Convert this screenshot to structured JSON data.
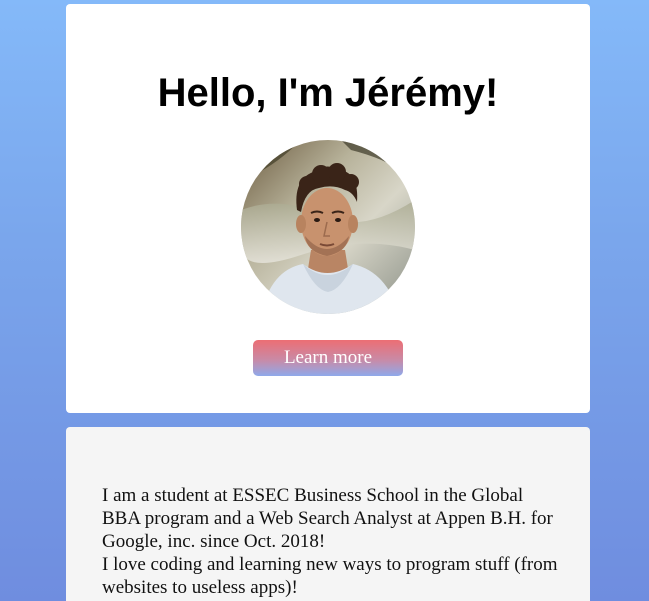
{
  "hero": {
    "title": "Hello, I'm Jérémy!",
    "learn_more_label": "Learn more",
    "avatar_alt": "profile-photo"
  },
  "about": {
    "line1": "I am a student at ESSEC Business School in the Global BBA program and a Web Search Analyst at Appen B.H. for Google, inc. since Oct. 2018!",
    "line2": "I love coding and learning new ways to program stuff (from websites to useless apps)!"
  },
  "colors": {
    "background_top": "#84b9f9",
    "background_bottom": "#6f8ddf",
    "button_top": "#ec6e74",
    "button_bottom": "#8fa9ea"
  }
}
